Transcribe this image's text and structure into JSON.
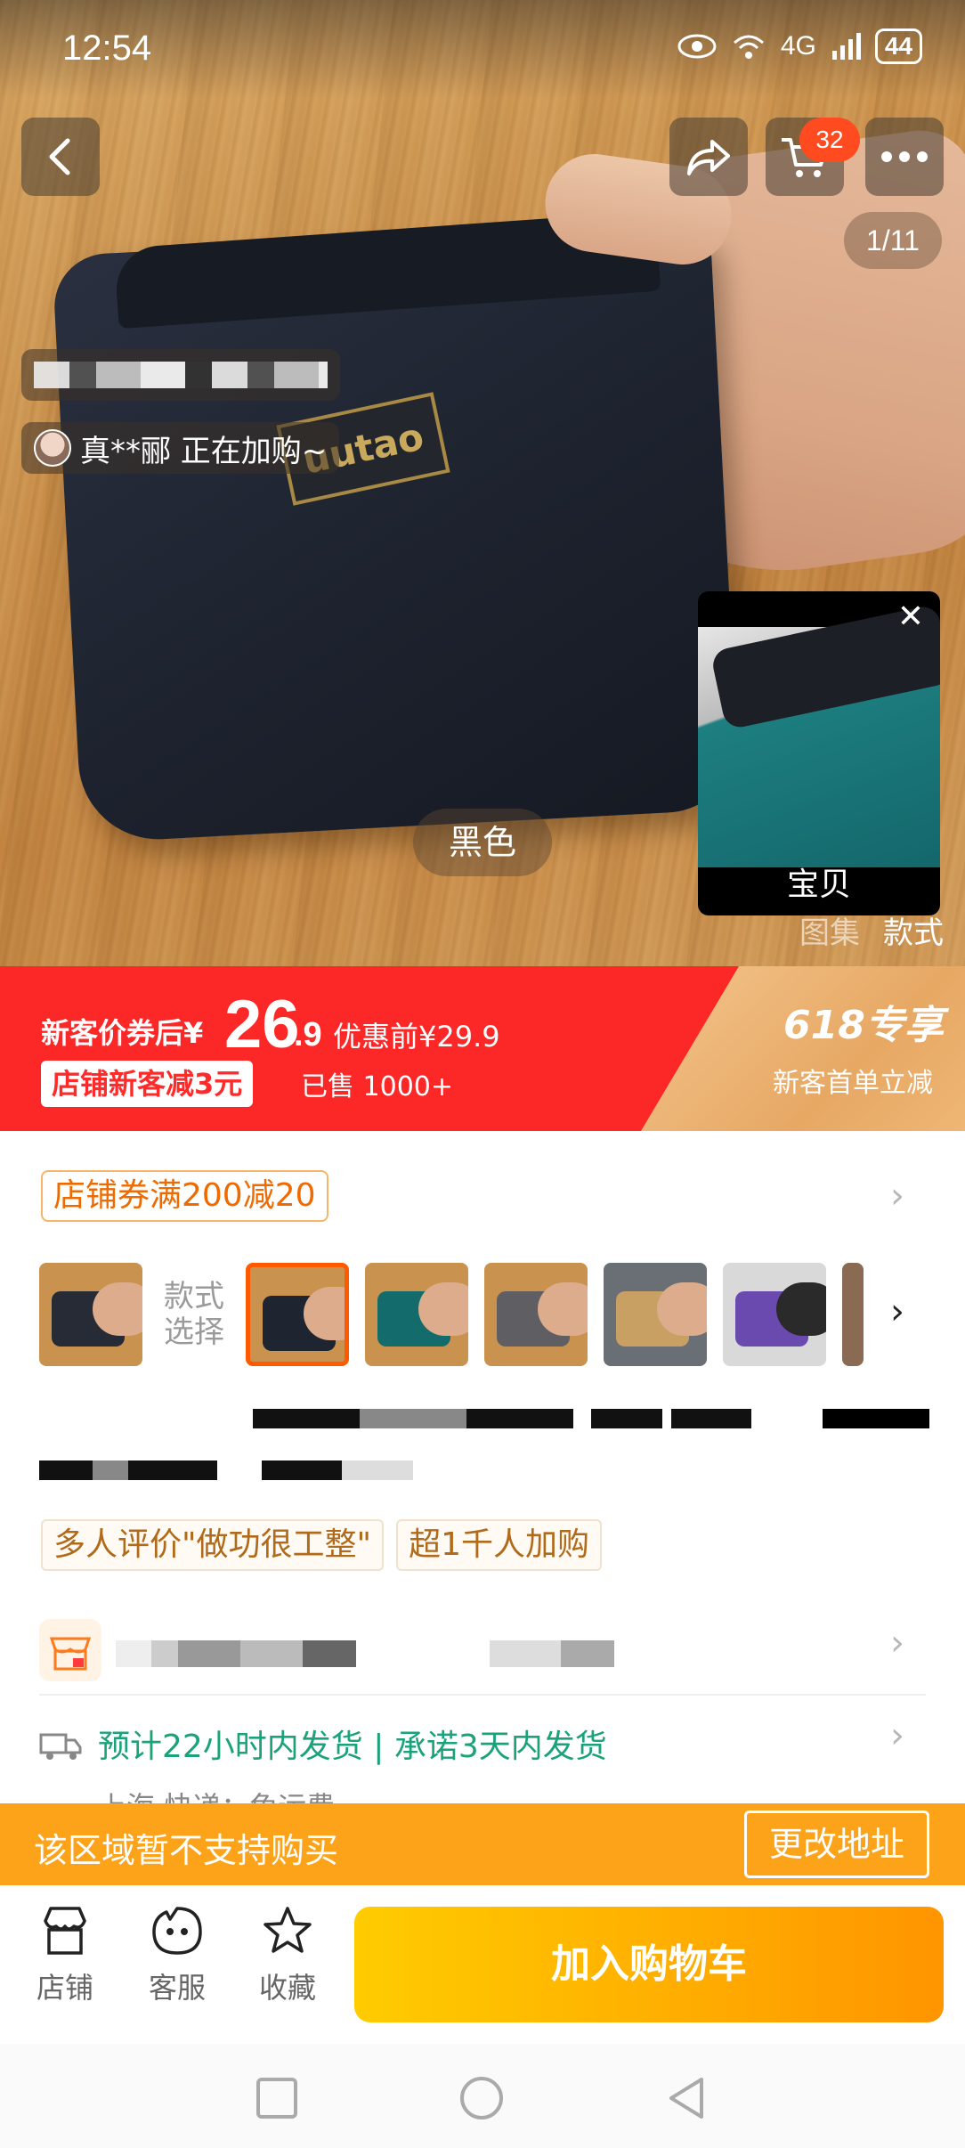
{
  "status_bar": {
    "time": "12:54",
    "network": "4G",
    "battery": "44"
  },
  "top_nav": {
    "cart_count": "32",
    "page_indicator": "1/11"
  },
  "hero": {
    "buyer_note": "真**郦 正在加购~",
    "color_tag": "黑色",
    "mini_player_caption": "宝贝",
    "media_tabs": [
      "图集",
      "款式"
    ],
    "brand_label": "uutao"
  },
  "price": {
    "label": "新客价券后",
    "currency": "¥",
    "integer": "26",
    "decimal": ".9",
    "original": "优惠前¥29.9",
    "shop_new_tag": "店铺新客减3元",
    "sold": "已售 1000+",
    "promo_title": "618专享",
    "promo_sub": "新客首单立减"
  },
  "coupon": {
    "label": "店铺券满200减20"
  },
  "variants": {
    "label_line1": "款式",
    "label_line2": "选择",
    "colors": [
      "#262b36",
      "#1e2430",
      "#136c6b",
      "#5f5f63",
      "#c9a064",
      "#6b4ab0",
      "#8a6a52"
    ]
  },
  "tags": [
    "多人评价\"做功很工整\"",
    "超1千人加购"
  ],
  "shipping": {
    "main": "预计22小时内发货 | 承诺3天内发货",
    "sub": "上海  快递：免运费"
  },
  "warning": {
    "text": "该区域暂不支持购买",
    "button": "更改地址"
  },
  "actions": {
    "store": "店铺",
    "service": "客服",
    "favorite": "收藏",
    "add_to_cart": "加入购物车"
  },
  "colors": {
    "price_red": "#fc2727",
    "accent_orange": "#ff5a00",
    "ship_green": "#1aa27a",
    "warn_orange": "#fca31a"
  }
}
